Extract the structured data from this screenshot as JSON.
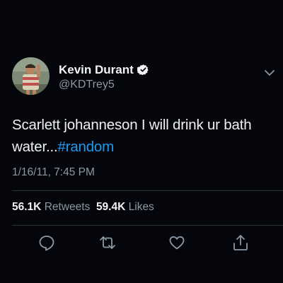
{
  "tweet": {
    "display_name": "Kevin Durant",
    "handle": "@KDTrey5",
    "verified_icon": "verified-badge-icon",
    "text_before": "Scarlett johanneson I will drink ur bath water...",
    "hashtag": "#random",
    "timestamp": "1/16/11, 7:45 PM",
    "retweets_count": "56.1K",
    "retweets_label": "Retweets",
    "likes_count": "59.4K",
    "likes_label": "Likes"
  },
  "icons": {
    "more": "chevron-down-icon",
    "reply": "reply-icon",
    "retweet": "retweet-icon",
    "like": "heart-icon",
    "share": "share-icon"
  },
  "colors": {
    "background": "#04060b",
    "text": "#eef0f3",
    "muted": "#8b98a5",
    "accent": "#1d9bf0",
    "divider": "#2f3336"
  }
}
